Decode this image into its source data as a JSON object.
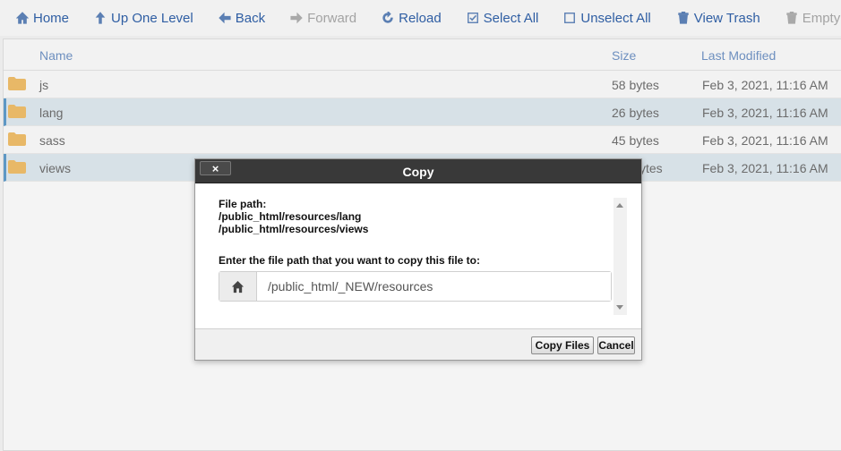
{
  "toolbar": {
    "items": [
      {
        "label": "Home",
        "icon": "home-icon",
        "enabled": true
      },
      {
        "label": "Up One Level",
        "icon": "arrow-up-icon",
        "enabled": true
      },
      {
        "label": "Back",
        "icon": "arrow-left-icon",
        "enabled": true
      },
      {
        "label": "Forward",
        "icon": "arrow-right-icon",
        "enabled": false
      },
      {
        "label": "Reload",
        "icon": "refresh-icon",
        "enabled": true
      },
      {
        "label": "Select All",
        "icon": "checkbox-checked-icon",
        "enabled": true
      },
      {
        "label": "Unselect All",
        "icon": "checkbox-empty-icon",
        "enabled": true
      },
      {
        "label": "View Trash",
        "icon": "trash-icon",
        "enabled": true
      },
      {
        "label": "Empty Trash",
        "icon": "trash-icon",
        "enabled": false
      }
    ]
  },
  "table": {
    "headers": {
      "name": "Name",
      "size": "Size",
      "modified": "Last Modified"
    },
    "rows": [
      {
        "name": "js",
        "size": "58 bytes",
        "modified": "Feb 3, 2021, 11:16 AM",
        "selected": false
      },
      {
        "name": "lang",
        "size": "26 bytes",
        "modified": "Feb 3, 2021, 11:16 AM",
        "selected": true
      },
      {
        "name": "sass",
        "size": "45 bytes",
        "modified": "Feb 3, 2021, 11:16 AM",
        "selected": false
      },
      {
        "name": "views",
        "size": "ytes",
        "modified": "Feb 3, 2021, 11:16 AM",
        "selected": true
      }
    ]
  },
  "dialog": {
    "title": "Copy",
    "close_label": "×",
    "file_path_label": "File path:",
    "file_paths": [
      "/public_html/resources/lang",
      "/public_html/resources/views"
    ],
    "prompt": "Enter the file path that you want to copy this file to:",
    "destination_value": "/public_html/_NEW/resources",
    "copy_button": "Copy Files",
    "cancel_button": "Cancel"
  },
  "colors": {
    "toolbar_link": "#2f5ea3",
    "disabled": "#a3a3a3",
    "folder": "#e8b867",
    "selected_row": "#d7e1e7",
    "dialog_header": "#393939"
  }
}
